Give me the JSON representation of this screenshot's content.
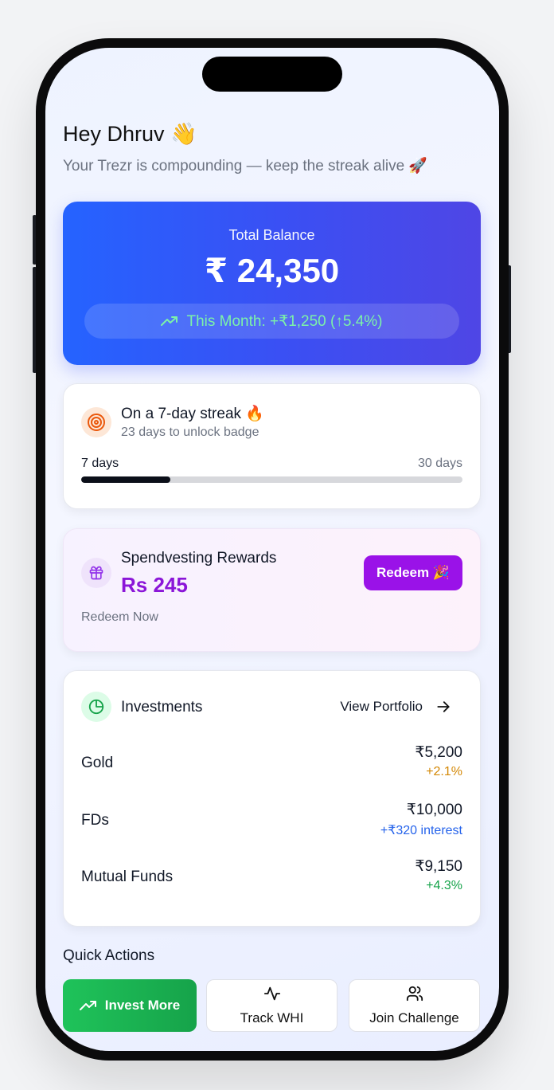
{
  "greeting": "Hey Dhruv 👋",
  "subtitle": "Your Trezr is compounding — keep the streak alive 🚀",
  "balance": {
    "label": "Total Balance",
    "amount": "₹ 24,350",
    "month_change": "This Month: +₹1,250 (↑5.4%)",
    "change_color": "#7cf2a8"
  },
  "streak": {
    "title": "On a 7-day streak 🔥",
    "note": "23 days to unlock badge",
    "start_label": "7 days",
    "end_label": "30 days",
    "progress": 0.233
  },
  "rewards": {
    "title": "Spendvesting Rewards",
    "points": "Rs 245",
    "button": "Redeem 🎉",
    "link": "Redeem Now"
  },
  "investments": {
    "title": "Investments",
    "view_label": "View Portfolio",
    "rows": [
      {
        "name": "Gold",
        "value": "₹5,200",
        "change": "+2.1%",
        "color": "#d48806"
      },
      {
        "name": "FDs",
        "value": "₹10,000",
        "change": "+₹320 interest",
        "color": "#2563eb"
      },
      {
        "name": "Mutual Funds",
        "value": "₹9,150",
        "change": "+4.3%",
        "color": "#16a34a"
      }
    ]
  },
  "quick_actions": {
    "title": "Quick Actions",
    "invest": "Invest More",
    "track": "Track WHI",
    "join": "Join Challenge"
  }
}
